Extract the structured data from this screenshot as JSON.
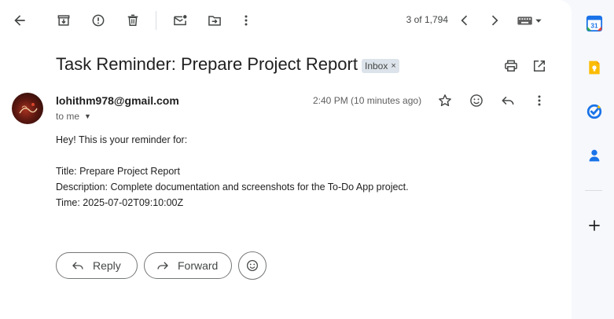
{
  "toolbar": {
    "back_icon": "arrow-left-icon",
    "archive_icon": "archive-icon",
    "report_spam_icon": "report-icon",
    "delete_icon": "trash-icon",
    "mark_unread_icon": "mail-dot-icon",
    "move_to_icon": "folder-move-icon",
    "more_icon": "more-vert-icon",
    "count_text": "3 of 1,794",
    "prev_icon": "chevron-left-icon",
    "next_icon": "chevron-right-icon",
    "input_tools_icon": "keyboard-icon"
  },
  "email": {
    "subject": "Task Reminder: Prepare Project Report",
    "label_chip": "Inbox",
    "label_chip_remove": "×",
    "print_icon": "print-icon",
    "open_new_window_icon": "open-in-new-icon",
    "sender": "lohithm978@gmail.com",
    "recipient": "to me",
    "time": "2:40 PM (10 minutes ago)",
    "star_icon": "star-icon",
    "react_icon": "emoji-icon",
    "reply_icon": "reply-icon",
    "more_icon": "more-vert-icon",
    "body_lines": [
      "Hey! This is your reminder for:",
      "",
      "Title: Prepare Project Report",
      "Description: Complete documentation and screenshots for the To-Do App project.",
      "Time: 2025-07-02T09:10:00Z"
    ]
  },
  "actions": {
    "reply_label": "Reply",
    "forward_label": "Forward"
  },
  "side_panel": {
    "apps": [
      {
        "name": "calendar-icon",
        "text": "31"
      },
      {
        "name": "keep-icon"
      },
      {
        "name": "tasks-icon"
      },
      {
        "name": "contacts-icon"
      }
    ],
    "add_icon": "plus-icon"
  },
  "colors": {
    "accent": "#0b57d0",
    "calendar_blue": "#1a73e8",
    "keep_yellow": "#fbbc04",
    "chip_bg": "#dde3ea"
  }
}
